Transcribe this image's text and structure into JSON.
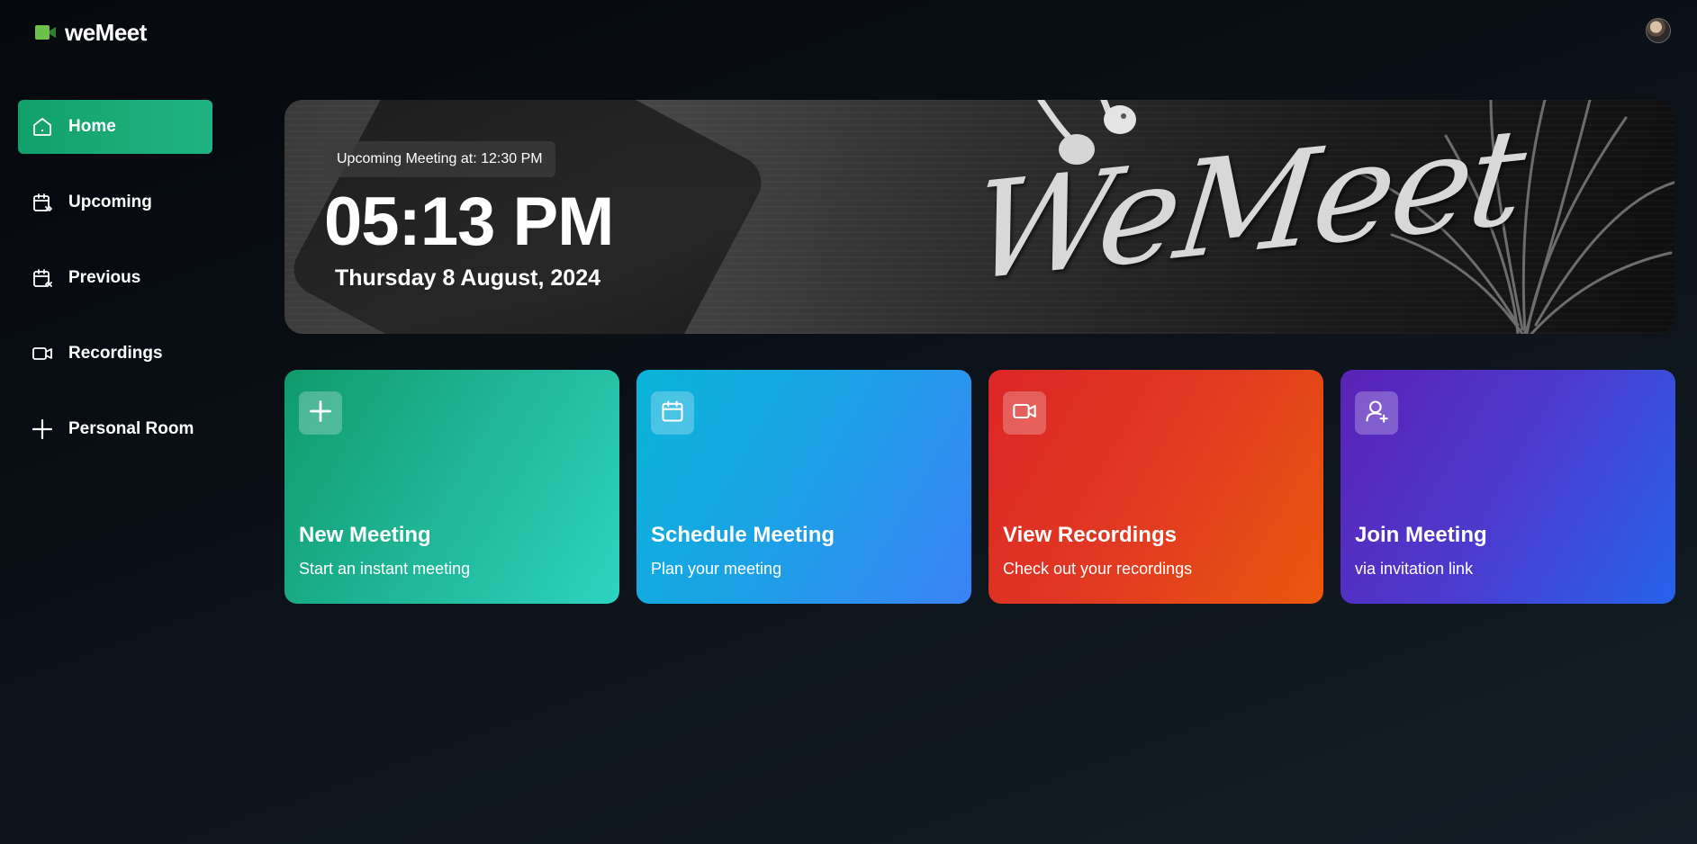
{
  "app": {
    "name": "weMeet",
    "accent": "#1fb382"
  },
  "header": {
    "logo_icon": "video-camera-icon",
    "avatar_icon": "user-avatar"
  },
  "sidebar": {
    "items": [
      {
        "label": "Home",
        "icon": "home-icon",
        "active": true
      },
      {
        "label": "Upcoming",
        "icon": "calendar-forward-icon",
        "active": false
      },
      {
        "label": "Previous",
        "icon": "calendar-back-icon",
        "active": false
      },
      {
        "label": "Recordings",
        "icon": "video-icon",
        "active": false
      },
      {
        "label": "Personal Room",
        "icon": "plus-icon",
        "active": false
      }
    ]
  },
  "hero": {
    "upcoming": "Upcoming Meeting at: 12:30 PM",
    "time": "05:13 PM",
    "date": "Thursday 8 August, 2024",
    "brand_script": "WeMeet"
  },
  "cards": [
    {
      "title": "New Meeting",
      "subtitle": "Start an instant meeting",
      "icon": "plus-icon",
      "color": "#1fb382"
    },
    {
      "title": "Schedule Meeting",
      "subtitle": "Plan your meeting",
      "icon": "calendar-icon",
      "color": "#0ea5e9"
    },
    {
      "title": "View Recordings",
      "subtitle": "Check out your recordings",
      "icon": "video-icon",
      "color": "#e13a22"
    },
    {
      "title": "Join Meeting",
      "subtitle": "via invitation link",
      "icon": "user-plus-icon",
      "color": "#4c3bce"
    }
  ]
}
